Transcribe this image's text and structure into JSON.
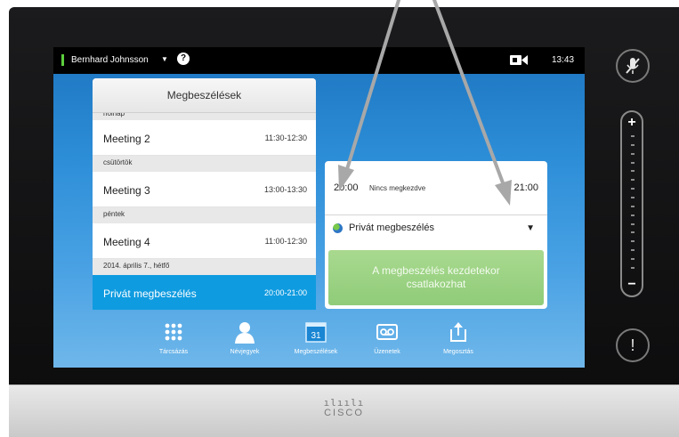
{
  "status_bar": {
    "user_name": "Bernhard Johnsson",
    "help_symbol": "?",
    "clock": "13:43",
    "status_color": "#5ccf3c"
  },
  "meetings_panel": {
    "title": "Megbeszélések",
    "top_cutoff_label": "holnap",
    "rows": [
      {
        "kind": "item",
        "name": "Meeting 2",
        "time": "11:30-12:30"
      },
      {
        "kind": "header",
        "label": "csütörtök"
      },
      {
        "kind": "item",
        "name": "Meeting 3",
        "time": "13:00-13:30"
      },
      {
        "kind": "header",
        "label": "péntek"
      },
      {
        "kind": "item",
        "name": "Meeting 4",
        "time": "11:00-12:30"
      },
      {
        "kind": "header",
        "label": "2014. április 7., hétfő"
      },
      {
        "kind": "item",
        "name": "Privát megbeszélés",
        "time": "20:00-21:00",
        "selected": true
      }
    ]
  },
  "meeting_detail": {
    "start_time": "20:00",
    "status": "Nincs megkezdve",
    "end_time": "21:00",
    "privacy": "Privát megbeszélés",
    "join_line1": "A megbeszélés kezdetekor",
    "join_line2": "csatlakozhat",
    "join_color": "#9bd385"
  },
  "dock": {
    "items": [
      {
        "label": "Tárcsázás",
        "icon": "keypad-icon"
      },
      {
        "label": "Névjegyek",
        "icon": "contacts-icon"
      },
      {
        "label": "Megbeszélések",
        "icon": "calendar-icon",
        "date": "31"
      },
      {
        "label": "Üzenetek",
        "icon": "voicemail-icon"
      },
      {
        "label": "Megosztás",
        "icon": "share-icon"
      }
    ]
  },
  "side_controls": {
    "volume_plus": "+",
    "volume_minus": "−",
    "alert_symbol": "!",
    "mute_icon": "microphone-mute-icon"
  },
  "brand": {
    "logo_bars": "ılıılı",
    "logo_text": "CISCO"
  },
  "colors": {
    "accent": "#0f9be0",
    "screen_background": "#2d8ed8"
  }
}
